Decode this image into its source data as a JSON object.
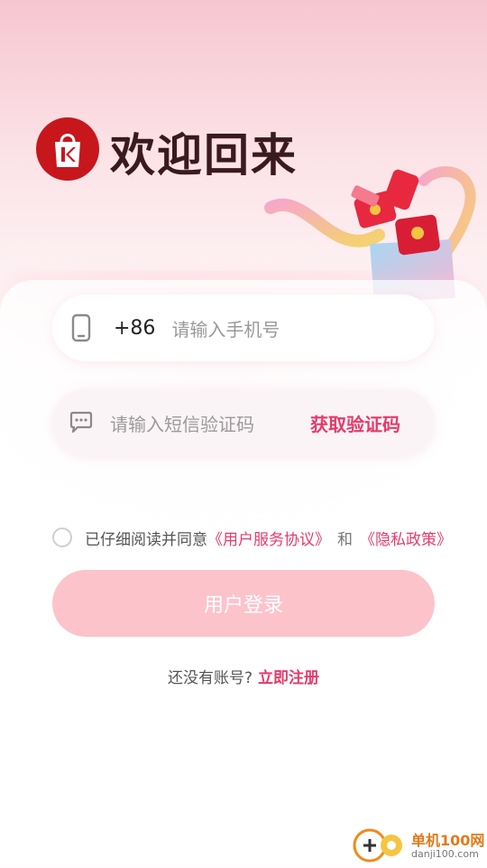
{
  "header": {
    "title": "欢迎回来",
    "logo_letter": "K"
  },
  "phone_field": {
    "prefix": "+86",
    "placeholder": "请输入手机号"
  },
  "code_field": {
    "placeholder": "请输入短信验证码",
    "get_code_label": "获取验证码"
  },
  "agreement": {
    "checked": false,
    "text": "已仔细阅读并同意",
    "terms_link": "《用户服务协议》",
    "and": "和",
    "privacy_link": "《隐私政策》"
  },
  "login_button": "用户登录",
  "register": {
    "question": "还没有账号?",
    "link": "立即注册"
  },
  "watermark": {
    "name": "单机100网",
    "url": "danji100.com"
  },
  "colors": {
    "accent": "#e63a6a",
    "logo_red": "#c8161d",
    "button_disabled": "#fcc3cb"
  }
}
